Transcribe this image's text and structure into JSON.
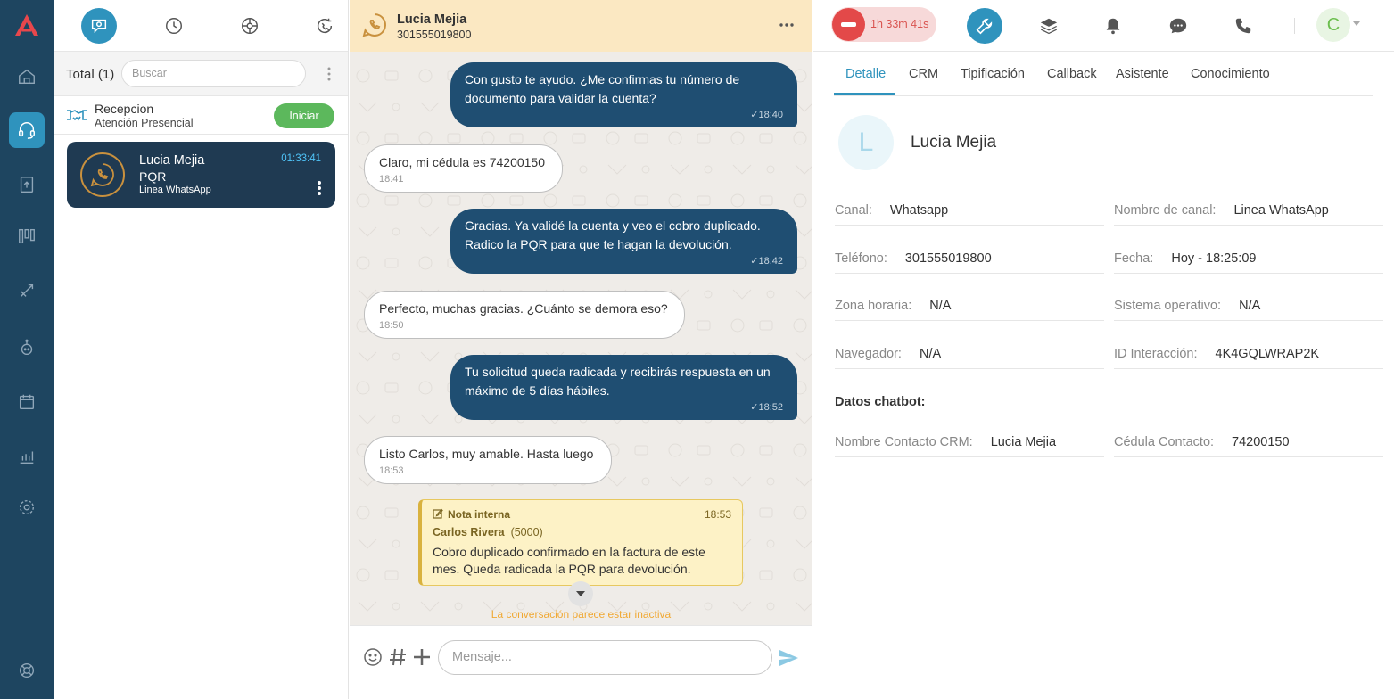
{
  "queue": {
    "total_label": "Total (1)",
    "search_placeholder": "Buscar",
    "reception": {
      "title": "Recepcion",
      "subtitle": "Atención Presencial",
      "start_label": "Iniciar"
    },
    "active_card": {
      "name": "Lucia Mejia",
      "type": "PQR",
      "channel": "Linea WhatsApp",
      "elapsed": "01:33:41"
    }
  },
  "chat": {
    "header": {
      "name": "Lucia Mejia",
      "phone": "301555019800"
    },
    "messages": [
      {
        "dir": "out",
        "text": "Con gusto te ayudo. ¿Me confirmas tu número de documento para validar la cuenta?",
        "time": "✓18:40"
      },
      {
        "dir": "in",
        "text": "Claro, mi cédula es 74200150",
        "time": "18:41"
      },
      {
        "dir": "out",
        "text": "Gracias. Ya validé la cuenta y veo el cobro duplicado. Radico la PQR para que te hagan la devolución.",
        "time": "✓18:42"
      },
      {
        "dir": "in",
        "text": "Perfecto, muchas gracias. ¿Cuánto se demora eso?",
        "time": "18:50"
      },
      {
        "dir": "out",
        "text": "Tu solicitud queda radicada y recibirás respuesta en un máximo de 5 días hábiles.",
        "time": "✓18:52"
      },
      {
        "dir": "in",
        "text": "Listo Carlos, muy amable. Hasta luego",
        "time": "18:53"
      }
    ],
    "note": {
      "title": "Nota interna",
      "time": "18:53",
      "author": "Carlos Rivera",
      "ext": "(5000)",
      "body": "Cobro duplicado confirmado en la factura de este mes. Queda radicada la PQR para devolución."
    },
    "inactive_text": "La conversación parece estar inactiva",
    "compose_placeholder": "Mensaje..."
  },
  "right": {
    "timer": "1h 33m 41s",
    "user_initial": "C",
    "tabs": [
      "Detalle",
      "CRM",
      "Tipificación",
      "Callback",
      "Asistente",
      "Conocimiento"
    ],
    "contact": {
      "initial": "L",
      "name": "Lucia Mejia"
    },
    "fields": {
      "canal": {
        "label": "Canal:",
        "value": "Whatsapp"
      },
      "nombre_canal": {
        "label": "Nombre de canal:",
        "value": "Linea WhatsApp"
      },
      "telefono": {
        "label": "Teléfono:",
        "value": "301555019800"
      },
      "fecha": {
        "label": "Fecha:",
        "value": "Hoy - 18:25:09"
      },
      "zona": {
        "label": "Zona horaria:",
        "value": "N/A"
      },
      "so": {
        "label": "Sistema operativo:",
        "value": "N/A"
      },
      "navegador": {
        "label": "Navegador:",
        "value": "N/A"
      },
      "id_interaccion": {
        "label": "ID Interacción:",
        "value": "4K4GQLWRAP2K"
      }
    },
    "chatbot_title": "Datos chatbot:",
    "chatbot": {
      "nombre_crm": {
        "label": "Nombre Contacto CRM:",
        "value": "Lucia Mejia"
      },
      "cedula": {
        "label": "Cédula Contacto:",
        "value": "74200150"
      }
    }
  },
  "colors": {
    "rail": "#1e4560",
    "accent": "#2f93bd",
    "chat_out": "#1f4e72",
    "header_bg": "#fbe8c2",
    "success": "#5cb85c",
    "danger": "#e34949"
  },
  "icons": {
    "rail": [
      "logo-icon",
      "home-icon",
      "headset-icon",
      "inbox-icon",
      "kanban-icon",
      "campaign-icon",
      "bot-icon",
      "calendar-icon",
      "reports-icon",
      "settings-icon",
      "help-icon"
    ],
    "queue_toolbar": [
      "agent-chat-icon",
      "history-icon",
      "omnichannel-icon",
      "callback-icon"
    ],
    "right_toolbar": [
      "wrench-icon",
      "layers-icon",
      "bell-icon",
      "chat-bubble-icon",
      "phone-icon"
    ]
  }
}
